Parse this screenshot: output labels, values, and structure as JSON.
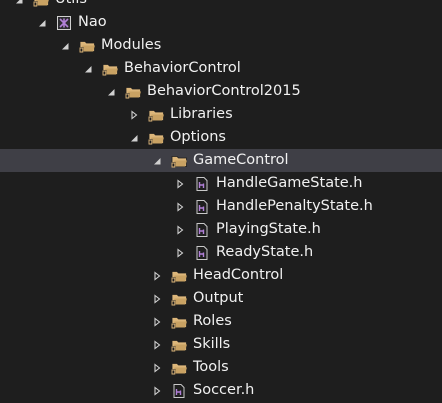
{
  "tree": {
    "rows": [
      {
        "label": "Utils",
        "depth": 0,
        "arrow": "expanded",
        "icon": "folder-icon"
      },
      {
        "label": "Nao",
        "depth": 1,
        "arrow": "expanded",
        "icon": "project-icon"
      },
      {
        "label": "Modules",
        "depth": 2,
        "arrow": "expanded",
        "icon": "folder-icon"
      },
      {
        "label": "BehaviorControl",
        "depth": 3,
        "arrow": "expanded",
        "icon": "folder-icon"
      },
      {
        "label": "BehaviorControl2015",
        "depth": 4,
        "arrow": "expanded",
        "icon": "folder-icon"
      },
      {
        "label": "Libraries",
        "depth": 5,
        "arrow": "collapsed",
        "icon": "folder-icon"
      },
      {
        "label": "Options",
        "depth": 5,
        "arrow": "expanded",
        "icon": "folder-icon"
      },
      {
        "label": "GameControl",
        "depth": 6,
        "arrow": "expanded",
        "icon": "folder-icon",
        "selected": true
      },
      {
        "label": "HandleGameState.h",
        "depth": 7,
        "arrow": "collapsed",
        "icon": "header-file-icon"
      },
      {
        "label": "HandlePenaltyState.h",
        "depth": 7,
        "arrow": "collapsed",
        "icon": "header-file-icon"
      },
      {
        "label": "PlayingState.h",
        "depth": 7,
        "arrow": "collapsed",
        "icon": "header-file-icon"
      },
      {
        "label": "ReadyState.h",
        "depth": 7,
        "arrow": "collapsed",
        "icon": "header-file-icon"
      },
      {
        "label": "HeadControl",
        "depth": 6,
        "arrow": "collapsed",
        "icon": "folder-icon"
      },
      {
        "label": "Output",
        "depth": 6,
        "arrow": "collapsed",
        "icon": "folder-icon"
      },
      {
        "label": "Roles",
        "depth": 6,
        "arrow": "collapsed",
        "icon": "folder-icon"
      },
      {
        "label": "Skills",
        "depth": 6,
        "arrow": "collapsed",
        "icon": "folder-icon"
      },
      {
        "label": "Tools",
        "depth": 6,
        "arrow": "collapsed",
        "icon": "folder-icon"
      },
      {
        "label": "Soccer.h",
        "depth": 6,
        "arrow": "collapsed",
        "icon": "header-file-icon"
      }
    ]
  },
  "colors": {
    "background": "#1e1e1e",
    "selected_row": "#3f3f46",
    "text": "#f1f1f1",
    "folder": "#dcb67a",
    "header_file": "#b180d7",
    "arrow": "#d0d0d0"
  }
}
